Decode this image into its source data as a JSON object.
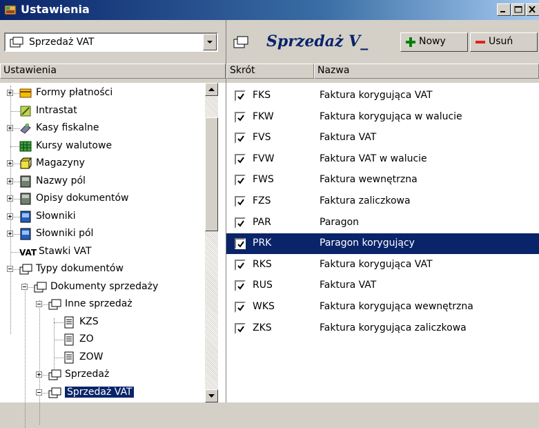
{
  "window": {
    "title": "Ustawienia"
  },
  "left": {
    "combo_value": "Sprzedaż VAT",
    "header": "Ustawienia",
    "tree": [
      {
        "label": "Formy płatności",
        "icon": "payment-icon"
      },
      {
        "label": "Intrastat",
        "icon": "intrastat-icon"
      },
      {
        "label": "Kasy fiskalne",
        "icon": "cash-register-icon"
      },
      {
        "label": "Kursy walutowe",
        "icon": "currency-table-icon"
      },
      {
        "label": "Magazyny",
        "icon": "warehouse-icon"
      },
      {
        "label": "Nazwy pól",
        "icon": "field-names-icon"
      },
      {
        "label": "Opisy dokumentów",
        "icon": "doc-descriptions-icon"
      },
      {
        "label": "Słowniki",
        "icon": "dictionary-icon"
      },
      {
        "label": "Słowniki pól",
        "icon": "field-dictionary-icon"
      },
      {
        "label": "Stawki VAT",
        "icon": "vat-icon"
      },
      {
        "label": "Typy dokumentów",
        "icon": "folder-icon"
      },
      {
        "label": "Dokumenty sprzedaży",
        "icon": "folder-icon"
      },
      {
        "label": "Inne sprzedaż",
        "icon": "folder-icon"
      },
      {
        "label": "KZS",
        "icon": "document-icon"
      },
      {
        "label": "ZO",
        "icon": "document-icon"
      },
      {
        "label": "ZOW",
        "icon": "document-icon"
      },
      {
        "label": "Sprzedaż",
        "icon": "folder-icon"
      },
      {
        "label": "Sprzedaż VAT",
        "icon": "folder-icon"
      }
    ]
  },
  "right": {
    "title": "Sprzedaż V_",
    "new_label": "Nowy",
    "delete_label": "Usuń",
    "columns": [
      "Skrót",
      "Nazwa"
    ],
    "rows": [
      {
        "code": "FKS",
        "name": "Faktura korygująca VAT",
        "checked": true
      },
      {
        "code": "FKW",
        "name": "Faktura korygująca w walucie",
        "checked": true
      },
      {
        "code": "FVS",
        "name": "Faktura VAT",
        "checked": true
      },
      {
        "code": "FVW",
        "name": "Faktura VAT w walucie",
        "checked": true
      },
      {
        "code": "FWS",
        "name": "Faktura wewnętrzna",
        "checked": true
      },
      {
        "code": "FZS",
        "name": "Faktura zaliczkowa",
        "checked": true
      },
      {
        "code": "PAR",
        "name": "Paragon",
        "checked": true
      },
      {
        "code": "PRK",
        "name": "Paragon korygujący",
        "checked": true,
        "selected": true
      },
      {
        "code": "RKS",
        "name": "Faktura korygująca VAT",
        "checked": true
      },
      {
        "code": "RUS",
        "name": "Faktura VAT",
        "checked": true
      },
      {
        "code": "WKS",
        "name": "Faktura korygująca wewnętrzna",
        "checked": true
      },
      {
        "code": "ZKS",
        "name": "Faktura korygująca zaliczkowa",
        "checked": true
      }
    ]
  },
  "colors": {
    "selection": "#0a246a",
    "title_accent": "#0a246a",
    "face": "#d4d0c8"
  }
}
